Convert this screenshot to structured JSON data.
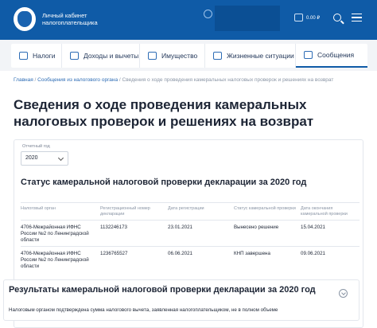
{
  "header": {
    "brand_line1": "Личный кабинет",
    "brand_line2": "налогоплательщика",
    "balance": "0.00 ₽",
    "icons": [
      "emblem-logo",
      "user-icon",
      "wallet-icon",
      "search-icon",
      "menu-icon"
    ]
  },
  "nav": {
    "items": [
      {
        "label": "Налоги",
        "icon": "taxes-icon"
      },
      {
        "label": "Доходы и вычеты",
        "icon": "income-icon"
      },
      {
        "label": "Имущество",
        "icon": "property-icon"
      },
      {
        "label": "Жизненные ситуации",
        "icon": "life-situations-icon"
      },
      {
        "label": "Сообщения",
        "icon": "messages-icon",
        "active": true
      }
    ]
  },
  "breadcrumb": {
    "home": "Главная",
    "sep1": " / ",
    "parent": "Сообщения из налогового органа",
    "sep2": " / ",
    "current": "Сведения о ходе проведения камеральных налоговых проверок и решениях на возврат"
  },
  "page_title": "Сведения о ходе проведения камеральных налоговых проверок и решениях на возврат",
  "filter": {
    "year_label": "Отчетный год",
    "year_value": "2020"
  },
  "status_section": {
    "title": "Статус камеральной налоговой проверки декларации за 2020 год",
    "columns": [
      "Налоговый орган",
      "Регистрационный номер декларации",
      "Дата регистрации",
      "Статус камеральной проверки",
      "Дата окончания камеральной проверки"
    ],
    "rows": [
      [
        "4706-Межрайонная ИФНС России №2 по Ленинградской области",
        "1132246173",
        "23.01.2021",
        "Вынесено решение",
        "15.04.2021"
      ],
      [
        "4706-Межрайонная ИФНС России №2 по Ленинградской области",
        "1236765527",
        "06.06.2021",
        "КНП завершена",
        "09.06.2021"
      ]
    ]
  },
  "results_section": {
    "title": "Результаты камеральной налоговой проверки декларации за 2020 год",
    "text": "Налоговым органом подтверждена сумма налогового вычета, заявленная налогоплательщиком, не в полном объеме"
  },
  "colors": {
    "header_bg": "#0f5ba7",
    "link": "#2d6cb5",
    "text": "#1d2535",
    "muted": "#8a95a5"
  }
}
